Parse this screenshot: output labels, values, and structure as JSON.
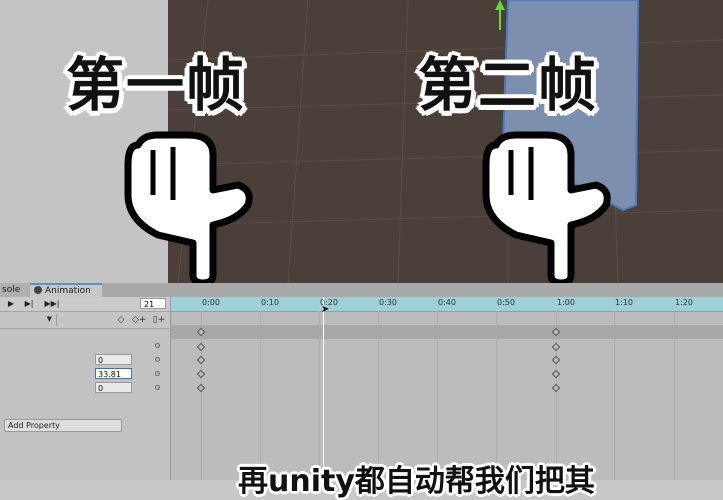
{
  "captions": {
    "first": "第一帧",
    "second": "第二帧"
  },
  "subtitle": "再unity都自动帮我们把其",
  "tabs": {
    "console": "sole",
    "animation": "Animation"
  },
  "controls": {
    "play": "▶",
    "next": "▶|",
    "last": "▶▶|",
    "frame": "21"
  },
  "tools": {
    "key": "◇",
    "add_key": "◇+",
    "event": "▯+"
  },
  "properties": {
    "values": [
      "0",
      "33.81",
      "0"
    ]
  },
  "add_property": "Add Property",
  "timeline": {
    "ticks": [
      "0:00",
      "0:10",
      "0:20",
      "0:30",
      "0:40",
      "0:50",
      "1:00",
      "1:10",
      "1:20"
    ],
    "current_frame": 21,
    "keyframes_at": [
      "0:00",
      "1:00"
    ]
  },
  "colors": {
    "ruler": "#9fd0d8",
    "scene_bg": "#4a3f39",
    "accent": "#5d8fd0"
  }
}
